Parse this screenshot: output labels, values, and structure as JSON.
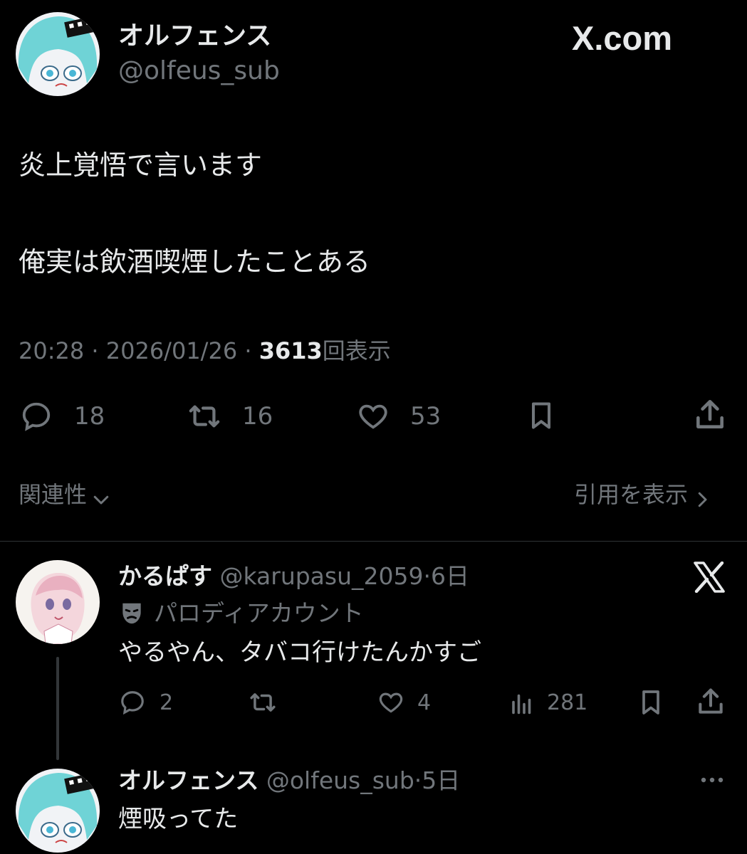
{
  "main_tweet": {
    "author_name": "オルフェンス",
    "author_handle": "@olfeus_sub",
    "site_label": "X.com",
    "text_line1": "炎上覚悟で言います",
    "text_line2": "俺実は飲酒喫煙したことある",
    "time": "20:28",
    "date": "2026/01/26",
    "views_count": "3613",
    "views_label": "回表示",
    "reply_count": "18",
    "retweet_count": "16",
    "like_count": "53",
    "related_label": "関連性",
    "quotes_label": "引用を表示"
  },
  "reply1": {
    "author_name": "かるぱす",
    "author_handle": "@karupasu_2059",
    "time": "6日",
    "parody_label": "パロディアカウント",
    "text": "やるやん、タバコ行けたんかすご",
    "reply_count": "2",
    "like_count": "4",
    "views_count": "281"
  },
  "reply2": {
    "author_name": "オルフェンス",
    "author_handle": "@olfeus_sub",
    "time": "5日",
    "text": "煙吸ってた"
  },
  "sep": "·",
  "colors": {
    "background": "#000000",
    "text": "#e7e9ea",
    "muted": "#71767b",
    "avatar_teal": "#6fd3d6"
  }
}
